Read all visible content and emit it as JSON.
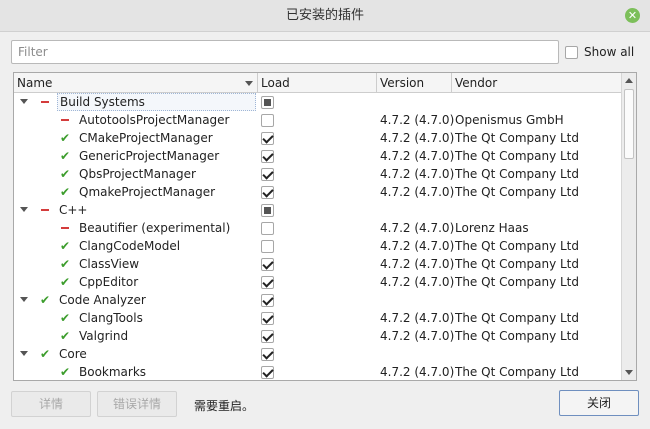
{
  "window": {
    "title": "已安装的插件",
    "close_icon": "close-icon"
  },
  "filter": {
    "placeholder": "Filter",
    "value": ""
  },
  "show_all": {
    "label": "Show all",
    "checked": false
  },
  "columns": {
    "name": "Name",
    "load": "Load",
    "version": "Version",
    "vendor": "Vendor"
  },
  "rows": [
    {
      "level": 0,
      "expanded": true,
      "status": "off",
      "name": "Build Systems",
      "load": "partial",
      "version": "",
      "vendor": "",
      "selected": true
    },
    {
      "level": 1,
      "status": "off",
      "name": "AutotoolsProjectManager",
      "load": "unchecked",
      "version": "4.7.2 (4.7.0)",
      "vendor": "Openismus GmbH"
    },
    {
      "level": 1,
      "status": "ok",
      "name": "CMakeProjectManager",
      "load": "checked",
      "version": "4.7.2 (4.7.0)",
      "vendor": "The Qt Company Ltd"
    },
    {
      "level": 1,
      "status": "ok",
      "name": "GenericProjectManager",
      "load": "checked",
      "version": "4.7.2 (4.7.0)",
      "vendor": "The Qt Company Ltd"
    },
    {
      "level": 1,
      "status": "ok",
      "name": "QbsProjectManager",
      "load": "checked",
      "version": "4.7.2 (4.7.0)",
      "vendor": "The Qt Company Ltd"
    },
    {
      "level": 1,
      "status": "ok",
      "name": "QmakeProjectManager",
      "load": "checked",
      "version": "4.7.2 (4.7.0)",
      "vendor": "The Qt Company Ltd"
    },
    {
      "level": 0,
      "expanded": true,
      "status": "off",
      "name": "C++",
      "load": "partial",
      "version": "",
      "vendor": ""
    },
    {
      "level": 1,
      "status": "off",
      "name": "Beautifier (experimental)",
      "load": "unchecked",
      "version": "4.7.2 (4.7.0)",
      "vendor": "Lorenz Haas"
    },
    {
      "level": 1,
      "status": "ok",
      "name": "ClangCodeModel",
      "load": "unchecked",
      "version": "4.7.2 (4.7.0)",
      "vendor": "The Qt Company Ltd"
    },
    {
      "level": 1,
      "status": "ok",
      "name": "ClassView",
      "load": "checked",
      "version": "4.7.2 (4.7.0)",
      "vendor": "The Qt Company Ltd"
    },
    {
      "level": 1,
      "status": "ok",
      "name": "CppEditor",
      "load": "checked",
      "version": "4.7.2 (4.7.0)",
      "vendor": "The Qt Company Ltd"
    },
    {
      "level": 0,
      "expanded": true,
      "status": "ok",
      "name": "Code Analyzer",
      "load": "checked",
      "version": "",
      "vendor": ""
    },
    {
      "level": 1,
      "status": "ok",
      "name": "ClangTools",
      "load": "checked",
      "version": "4.7.2 (4.7.0)",
      "vendor": "The Qt Company Ltd"
    },
    {
      "level": 1,
      "status": "ok",
      "name": "Valgrind",
      "load": "checked",
      "version": "4.7.2 (4.7.0)",
      "vendor": "The Qt Company Ltd"
    },
    {
      "level": 0,
      "expanded": true,
      "status": "ok",
      "name": "Core",
      "load": "checked",
      "version": "",
      "vendor": ""
    },
    {
      "level": 1,
      "status": "ok",
      "name": "Bookmarks",
      "load": "checked",
      "version": "4.7.2 (4.7.0)",
      "vendor": "The Qt Company Ltd"
    }
  ],
  "buttons": {
    "details": "详情",
    "error_details": "错误详情",
    "close": "关闭"
  },
  "restart_notice": "需要重启。",
  "colors": {
    "ok": "#3c9d2c",
    "off": "#d43c3c"
  }
}
